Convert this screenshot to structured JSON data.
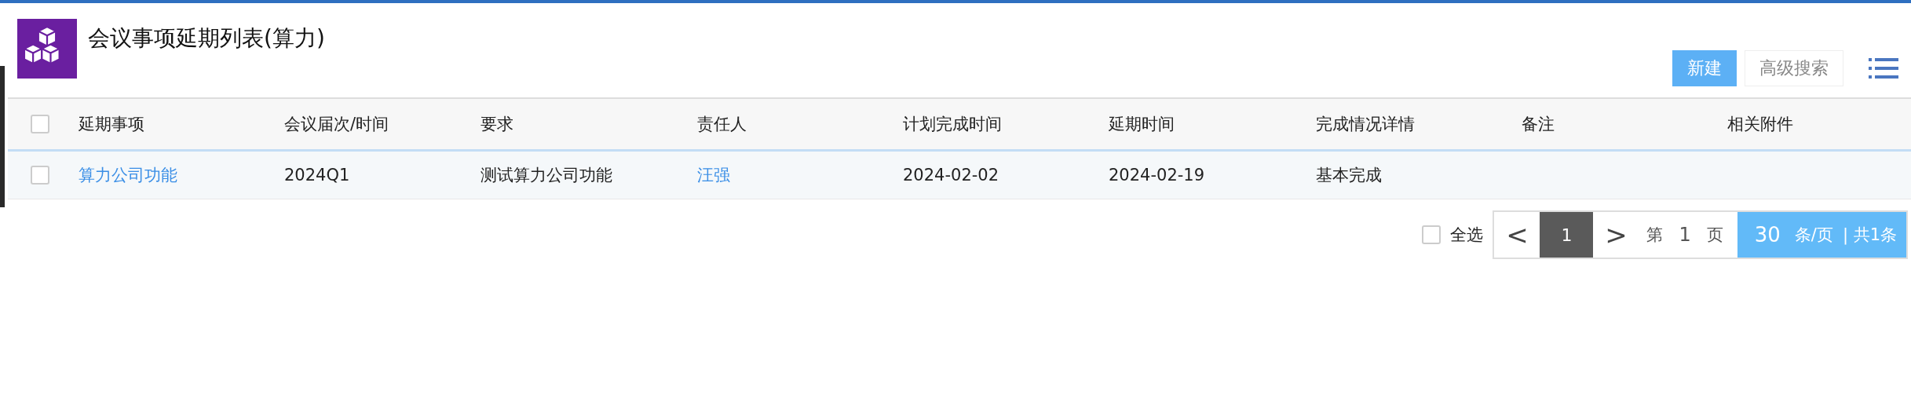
{
  "header": {
    "title": "会议事项延期列表(算力)",
    "buttons": [
      {
        "label": "新建",
        "kind": "primary"
      },
      {
        "label": "高级搜索",
        "kind": "secondary"
      }
    ]
  },
  "table": {
    "select_all_checked": false,
    "columns": [
      "延期事项",
      "会议届次/时间",
      "要求",
      "责任人",
      "计划完成时间",
      "延期时间",
      "完成情况详情",
      "备注",
      "相关附件"
    ],
    "rows": [
      {
        "selected": false,
        "cells": [
          {
            "text": "算力公司功能",
            "kind": "link"
          },
          {
            "text": "2024Q1",
            "kind": "text"
          },
          {
            "text": "测试算力公司功能",
            "kind": "text"
          },
          {
            "text": "汪强",
            "kind": "link"
          },
          {
            "text": "2024-02-02",
            "kind": "text"
          },
          {
            "text": "2024-02-19",
            "kind": "text"
          },
          {
            "text": "基本完成",
            "kind": "text"
          }
        ]
      }
    ]
  },
  "pager": {
    "select_all": {
      "label": "全选",
      "checked": false
    },
    "prev": "<",
    "pages": [
      {
        "label": "1",
        "selected": true
      }
    ],
    "next": ">",
    "page_prefix": "第",
    "current_page": "1",
    "page_suffix": "页",
    "page_size": "30",
    "page_size_unit": "条/页",
    "total": "| 共1条"
  }
}
